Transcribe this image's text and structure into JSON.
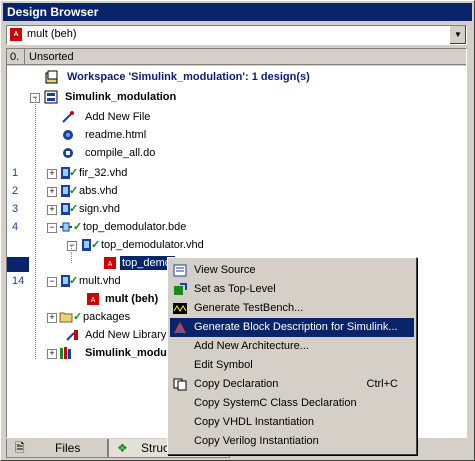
{
  "window": {
    "title": "Design Browser"
  },
  "combo": {
    "value": "mult (beh)"
  },
  "header": {
    "col0": "0.",
    "col1": "Unsorted"
  },
  "tree": {
    "workspace": "Workspace 'Simulink_modulation': 1 design(s)",
    "design": "Simulink_modulation",
    "add_new_file": "Add New File",
    "readme": "readme.html",
    "compile": "compile_all.do",
    "fir": "fir_32.vhd",
    "abs": "abs.vhd",
    "sign": "sign.vhd",
    "top_bde": "top_demodulator.bde",
    "top_vhd": "top_demodulator.vhd",
    "top_inst": "top_demo",
    "mult_vhd": "mult.vhd",
    "mult_beh": "mult (beh)",
    "packages": "packages",
    "add_new_lib": "Add New Library",
    "simulink_lib": "Simulink_modul",
    "nums": [
      "1",
      "2",
      "3",
      "4",
      "14"
    ]
  },
  "menu": {
    "items": [
      "View Source",
      "Set as Top-Level",
      "Generate TestBench...",
      "Generate Block Description for Simulink...",
      "Add New Architecture...",
      "Edit Symbol",
      "Copy Declaration",
      "Copy SystemC Class Declaration",
      "Copy VHDL Instantiation",
      "Copy Verilog Instantiation"
    ],
    "shortcut_copy": "Ctrl+C"
  },
  "tabs": {
    "files": "Files",
    "structure": "Struc"
  },
  "colors": {
    "selection": "#0a246a",
    "check": "#0a8a0a",
    "accent_red": "#cc0000"
  }
}
